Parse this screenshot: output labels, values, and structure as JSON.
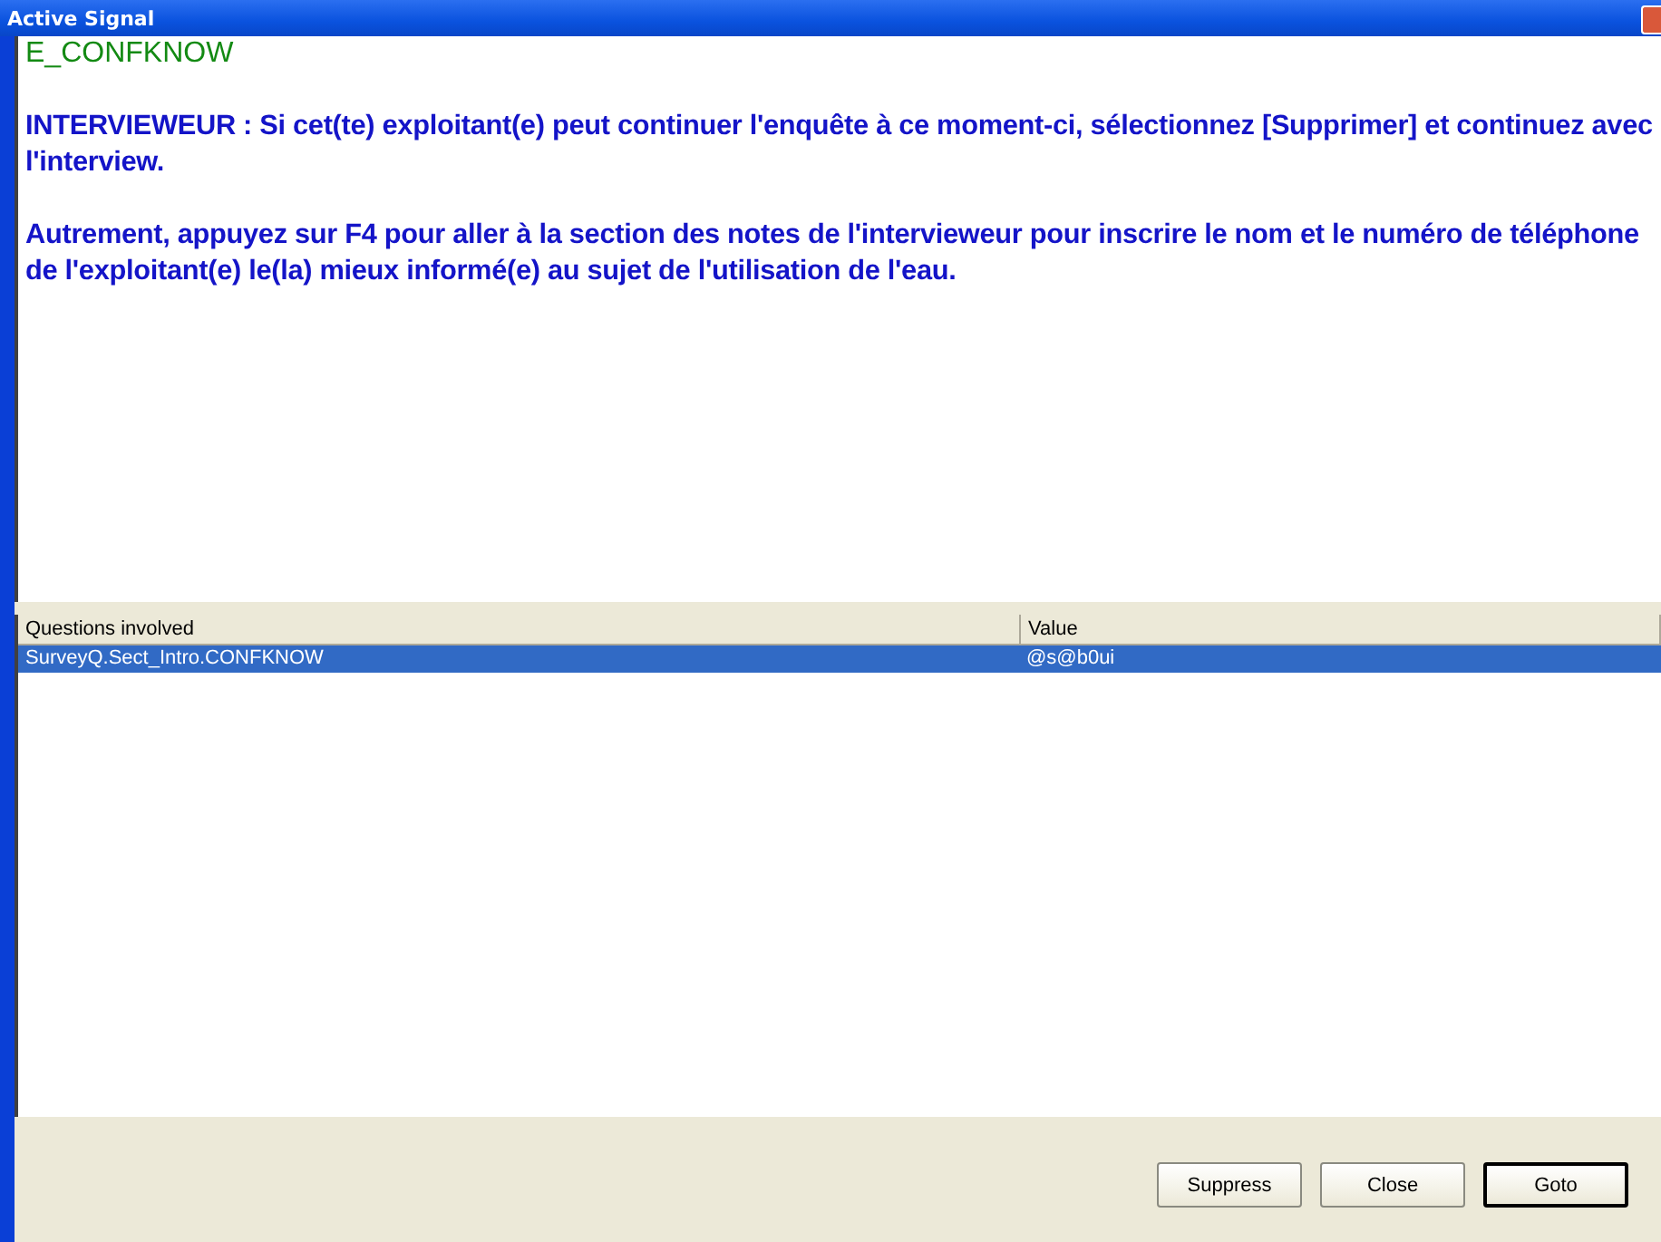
{
  "window": {
    "title": "Active Signal"
  },
  "message": {
    "code": "E_CONFKNOW",
    "paragraphs": [
      "INTERVIEWEUR : Si cet(te) exploitant(e) peut continuer l'enquête à ce moment-ci, sélectionnez [Supprimer] et continuez avec l'interview.",
      "Autrement, appuyez sur F4 pour aller à la section des notes de l'intervieweur pour inscrire le nom et le numéro de téléphone de l'exploitant(e) le(la) mieux informé(e) au sujet de l'utilisation de l'eau."
    ]
  },
  "table": {
    "columns": [
      "Questions involved",
      "Value"
    ],
    "rows": [
      {
        "question": "SurveyQ.Sect_Intro.CONFKNOW",
        "value": "@s@b0ui",
        "selected": true
      }
    ]
  },
  "buttons": [
    {
      "label": "Suppress",
      "default": false
    },
    {
      "label": "Close",
      "default": false
    },
    {
      "label": "Goto",
      "default": true
    }
  ]
}
